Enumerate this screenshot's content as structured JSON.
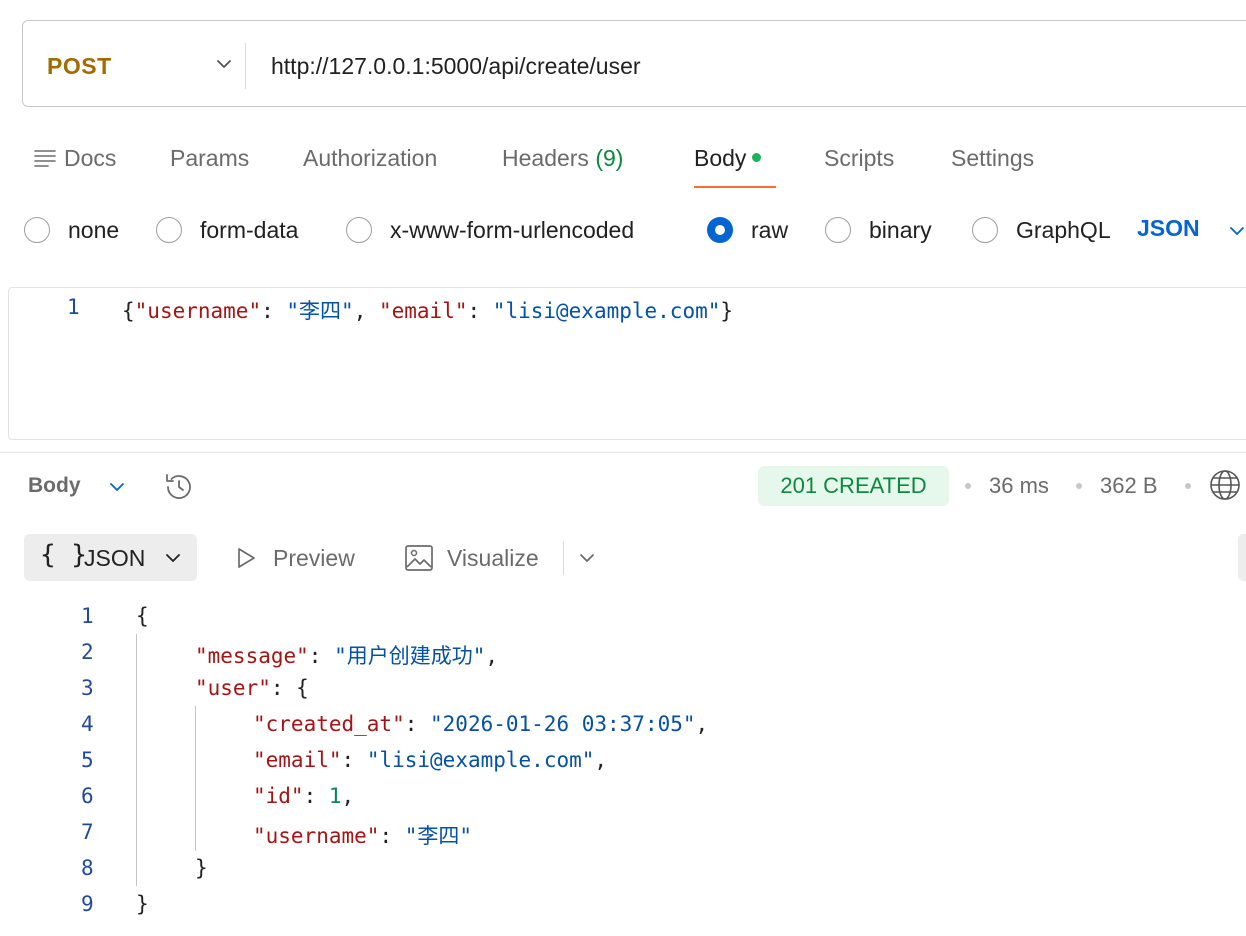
{
  "request": {
    "method": "POST",
    "url": "http://127.0.0.1:5000/api/create/user"
  },
  "tabs": [
    {
      "label": "Docs"
    },
    {
      "label": "Params"
    },
    {
      "label": "Authorization"
    },
    {
      "label": "Headers",
      "count": "(9)"
    },
    {
      "label": "Body",
      "active": true
    },
    {
      "label": "Scripts"
    },
    {
      "label": "Settings"
    }
  ],
  "body_types": {
    "options": [
      "none",
      "form-data",
      "x-www-form-urlencoded",
      "raw",
      "binary",
      "GraphQL"
    ],
    "selected": "raw",
    "format": "JSON"
  },
  "request_body": {
    "line_number": "1",
    "open_brace": "{",
    "key1": "\"username\"",
    "colon1": ": ",
    "val1": "\"李四\"",
    "comma1": ", ",
    "key2": "\"email\"",
    "colon2": ": ",
    "val2": "\"lisi@example.com\"",
    "close_brace": "}"
  },
  "response": {
    "section_label": "Body",
    "status": "201 CREATED",
    "time": "36 ms",
    "size": "362 B",
    "view": {
      "json_label": "JSON",
      "braces": "{ }",
      "preview_label": "Preview",
      "visualize_label": "Visualize"
    },
    "lines": [
      {
        "num": "1",
        "open": "{"
      },
      {
        "num": "2",
        "key": "\"message\"",
        "sep": ": ",
        "val": "\"用户创建成功\"",
        "end": ","
      },
      {
        "num": "3",
        "key": "\"user\"",
        "sep": ": ",
        "open": "{"
      },
      {
        "num": "4",
        "key": "\"created_at\"",
        "sep": ": ",
        "val": "\"2026-01-26 03:37:05\"",
        "end": ","
      },
      {
        "num": "5",
        "key": "\"email\"",
        "sep": ": ",
        "val": "\"lisi@example.com\"",
        "end": ","
      },
      {
        "num": "6",
        "key": "\"id\"",
        "sep": ": ",
        "val": "1",
        "end": ","
      },
      {
        "num": "7",
        "key": "\"username\"",
        "sep": ": ",
        "val": "\"李四\""
      },
      {
        "num": "8",
        "close": "}"
      },
      {
        "num": "9",
        "close": "}"
      }
    ]
  },
  "colors": {
    "method": "#a36a00",
    "accent_orange": "#ff6c37",
    "link_blue": "#0265d2",
    "success_green": "#0b8a3e",
    "json_key": "#a31515",
    "json_string": "#0451a5",
    "json_number": "#098658"
  },
  "icons": [
    "chevron-down-icon",
    "docs-icon",
    "history-icon",
    "globe-icon",
    "play-icon",
    "image-icon"
  ]
}
